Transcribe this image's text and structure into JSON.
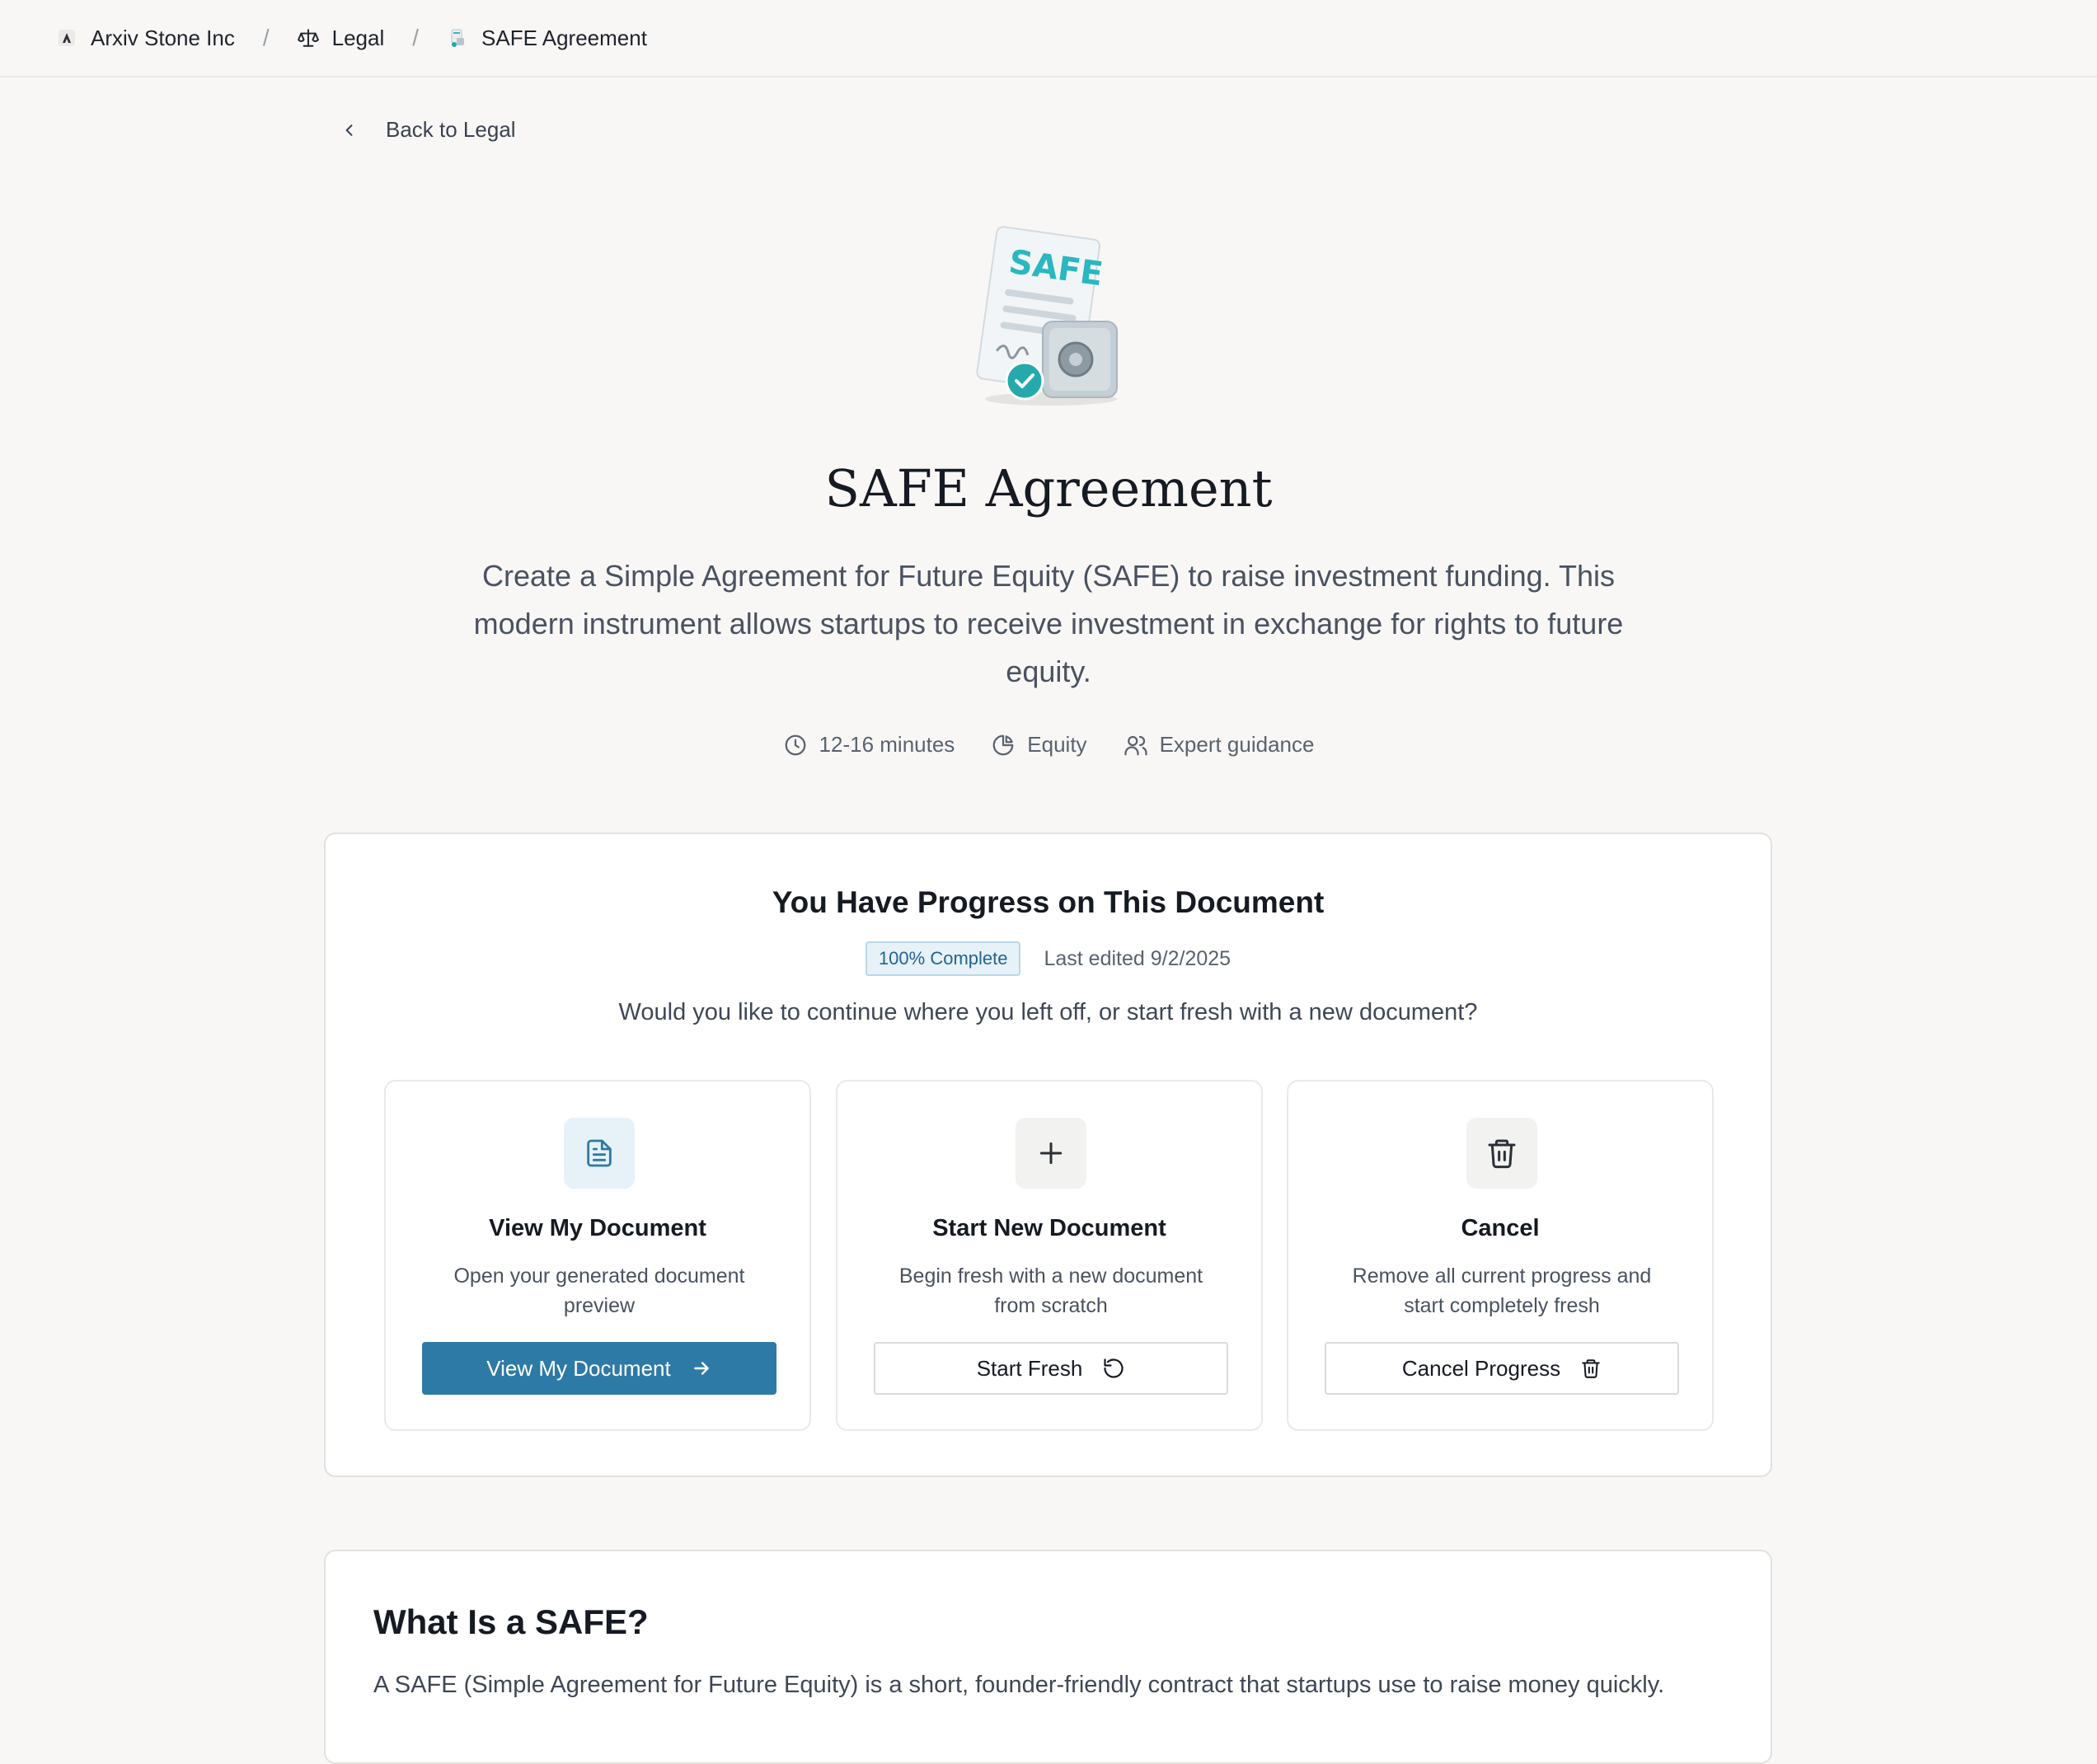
{
  "breadcrumb": {
    "items": [
      {
        "label": "Arxiv Stone Inc",
        "icon": "company-logo-icon"
      },
      {
        "label": "Legal",
        "icon": "scale-icon"
      },
      {
        "label": "SAFE Agreement",
        "icon": "safe-document-icon"
      }
    ],
    "separator": "/"
  },
  "back_link": {
    "label": "Back to Legal"
  },
  "hero": {
    "icon": "safe-agreement-illustration",
    "icon_text": "SAFE",
    "title": "SAFE Agreement",
    "description": "Create a Simple Agreement for Future Equity (SAFE) to raise investment funding. This modern instrument allows startups to receive investment in exchange for rights to future equity.",
    "meta": [
      {
        "icon": "clock-icon",
        "label": "12-16 minutes"
      },
      {
        "icon": "pie-chart-icon",
        "label": "Equity"
      },
      {
        "icon": "users-icon",
        "label": "Expert guidance"
      }
    ]
  },
  "progress_card": {
    "title": "You Have Progress on This Document",
    "badge": "100% Complete",
    "progress": 100,
    "last_edited": "Last edited 9/2/2025",
    "question": "Would you like to continue where you left off, or start fresh with a new document?",
    "options": [
      {
        "icon": "document-icon",
        "title": "View My Document",
        "description": "Open your generated document preview",
        "button": "View My Document",
        "button_icon": "arrow-right-icon"
      },
      {
        "icon": "plus-icon",
        "title": "Start New Document",
        "description": "Begin fresh with a new document from scratch",
        "button": "Start Fresh",
        "button_icon": "refresh-icon"
      },
      {
        "icon": "trash-icon",
        "title": "Cancel",
        "description": "Remove all current progress and start completely fresh",
        "button": "Cancel Progress",
        "button_icon": "trash-icon"
      }
    ]
  },
  "info_card": {
    "title": "What Is a SAFE?",
    "text": "A SAFE (Simple Agreement for Future Equity) is a short, founder-friendly contract that startups use to raise money quickly."
  },
  "colors": {
    "background": "#f8f7f5",
    "primary": "#2e7aa6",
    "badge_bg": "#e7f1f8",
    "text": "#161a22",
    "muted": "#5a6270"
  }
}
